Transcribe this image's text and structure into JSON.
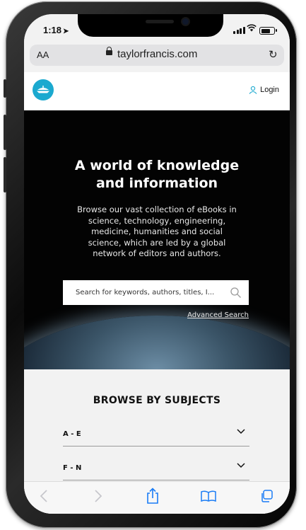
{
  "status_bar": {
    "time": "1:18"
  },
  "browser": {
    "text_size_button": "AA",
    "url": "taylorfrancis.com"
  },
  "site_header": {
    "login_label": "Login"
  },
  "hero": {
    "title_line1": "A world of knowledge",
    "title_line2": "and information",
    "description": "Browse our vast collection of eBooks in science, technology, engineering, medicine, humanities and social science, which are led by a global network of editors and authors.",
    "search_placeholder": "Search for keywords, authors, titles, I...",
    "advanced_search": "Advanced Search"
  },
  "browse": {
    "title": "BROWSE BY SUBJECTS",
    "items": [
      {
        "label": "A - E"
      },
      {
        "label": "F - N"
      }
    ]
  },
  "icons": [
    "location-arrow-icon",
    "signal-icon",
    "wifi-icon",
    "battery-icon",
    "lock-icon",
    "reload-icon",
    "logo-icon",
    "user-icon",
    "search-icon",
    "chevron-down-icon",
    "back-icon",
    "forward-icon",
    "share-icon",
    "bookmarks-icon",
    "tabs-icon"
  ],
  "colors": {
    "brand": "#1ba9cf",
    "hero_bg": "#030303"
  }
}
